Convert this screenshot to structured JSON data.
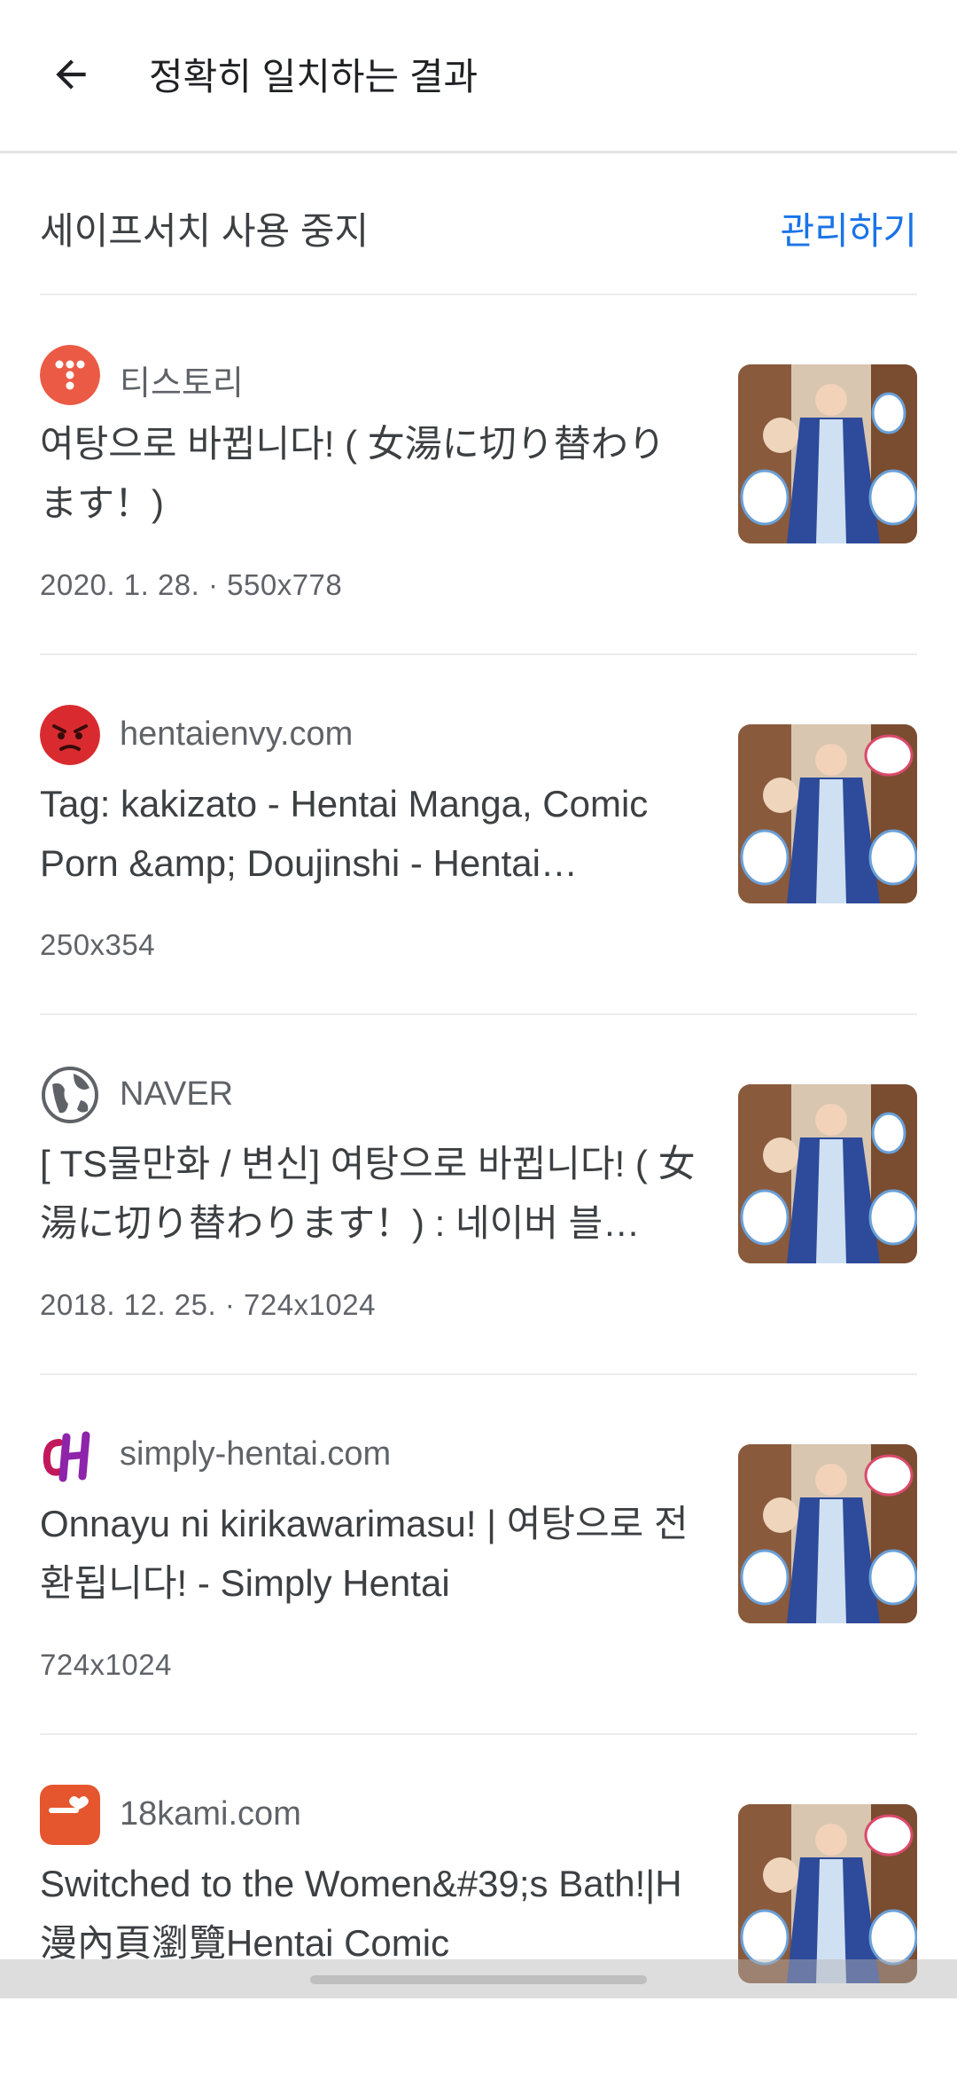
{
  "header": {
    "title": "정확히 일치하는 결과"
  },
  "safesearch": {
    "label": "세이프서치 사용 중지",
    "manage_label": "관리하기"
  },
  "results": [
    {
      "site": "티스토리",
      "title": "여탕으로 바뀝니다! ( 女湯に切り替わります！)",
      "meta": "2020. 1. 28. · 550x778",
      "favicon": "tistory-icon"
    },
    {
      "site": "hentaienvy.com",
      "title": "Tag: kakizato - Hentai Manga, Comic Porn &amp; Doujinshi - Hentai…",
      "meta": "250x354",
      "favicon": "angry-face-icon"
    },
    {
      "site": "NAVER",
      "title": "[ TS물만화 / 변신] 여탕으로 바뀝니다! ( 女湯に切り替わります！) : 네이버 블…",
      "meta": "2018. 12. 25. · 724x1024",
      "favicon": "globe-icon"
    },
    {
      "site": "simply-hentai.com",
      "title": "Onnayu ni kirikawarimasu! | 여탕으로 전환됩니다! - Simply Hentai",
      "meta": "724x1024",
      "favicon": "sh-logo-icon"
    },
    {
      "site": "18kami.com",
      "title": "Switched to the Women&#39;s Bath!|H漫內頁瀏覽Hentai Comic",
      "meta": "",
      "favicon": "18kami-logo-icon"
    }
  ],
  "colors": {
    "accent": "#1a73e8",
    "text": "#202124",
    "secondary": "#5f6368",
    "divider": "#ececec"
  }
}
